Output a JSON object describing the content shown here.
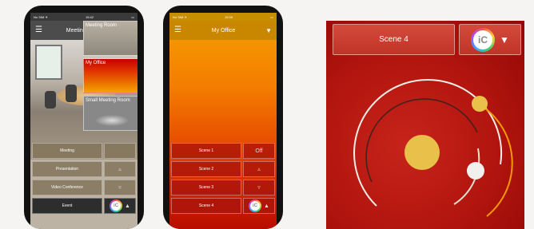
{
  "phone1": {
    "status_carrier": "No SIM ✈",
    "status_time": "15:42",
    "title": "Meeting Room",
    "rooms": [
      "Meeting Room",
      "My Office",
      "Small Meeting Room"
    ],
    "buttons": [
      {
        "label": "Meeting",
        "side": ""
      },
      {
        "label": "Presentation",
        "side": "▵"
      },
      {
        "label": "Video Conference",
        "side": "▿"
      },
      {
        "label": "Event",
        "side": "▲"
      }
    ]
  },
  "phone2": {
    "status_carrier": "No SIM ✈",
    "status_time": "15:39",
    "title": "My Office",
    "buttons": [
      {
        "label": "Scene 1",
        "side": "Off"
      },
      {
        "label": "Scene 2",
        "side": "▵"
      },
      {
        "label": "Scene 3",
        "side": "▿"
      },
      {
        "label": "Scene 4",
        "side": "▲"
      }
    ]
  },
  "panel": {
    "scene_label": "Scene 4",
    "logo_text": "iC",
    "dropdown_glyph": "▼"
  },
  "colors": {
    "accent_yellow": "#e8c04a",
    "panel_red": "#b0140e",
    "orange": "#f09000"
  }
}
